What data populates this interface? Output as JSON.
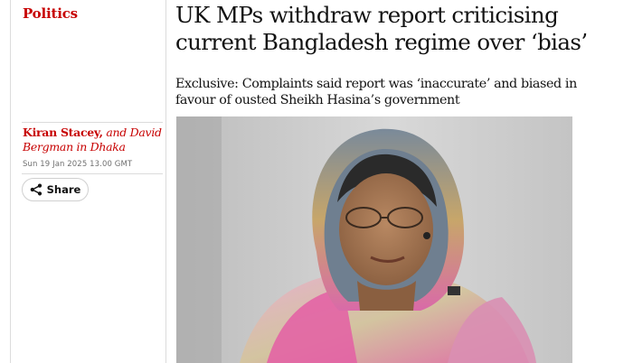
{
  "article": {
    "section": "Politics",
    "headline": "UK MPs withdraw report criticising current Bangladesh regime over ‘bias’",
    "standfirst": "Exclusive: Complaints said report was ‘inaccurate’ and biased in favour of ousted Sheikh Hasina’s government",
    "byline": {
      "author": "Kiran Stacey,",
      "rest": " and David Bergman in Dhaka"
    },
    "dateline": "Sun 19 Jan 2025 13.00 GMT",
    "share_label": "Share",
    "share_icon": "share-icon"
  },
  "colors": {
    "section_red": "#c70000",
    "text": "#121212",
    "muted": "#707070",
    "rule": "#dcdcdc"
  }
}
